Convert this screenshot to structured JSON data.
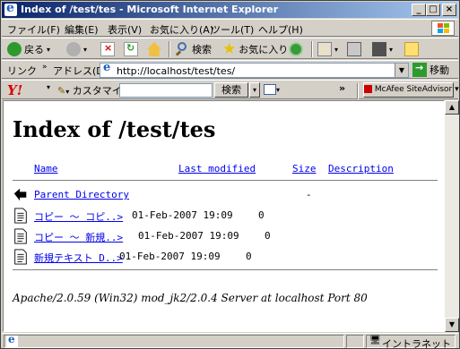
{
  "window": {
    "title": "Index of /test/tes - Microsoft Internet Explorer",
    "minimize": "_",
    "maximize": "□",
    "close": "×"
  },
  "menu": {
    "items": [
      "ファイル(F)",
      "編集(E)",
      "表示(V)",
      "お気に入り(A)",
      "ツール(T)",
      "ヘルプ(H)"
    ]
  },
  "toolbar": {
    "back_label": "戻る",
    "search_label": "検索",
    "favorites_label": "お気に入り"
  },
  "address": {
    "label": "リンク",
    "address_label": "アドレス(D)",
    "url": "http://localhost/test/tes/",
    "go_label": "移動"
  },
  "yahoo": {
    "logo": "Y!",
    "customize_label": "カスタマイズ",
    "search_button": "検索",
    "more": "»",
    "mcafee": "McAfee SiteAdvisor"
  },
  "page": {
    "heading": "Index of /test/tes",
    "columns": {
      "name": "Name",
      "last_modified": "Last modified",
      "size": "Size",
      "description": "Description"
    },
    "parent": {
      "label": "Parent Directory",
      "size": "-"
    },
    "entries": [
      {
        "name": "コピー ～ コピ..>",
        "modified": "01-Feb-2007 19:09",
        "size": "0"
      },
      {
        "name": "コピー ～ 新規..>",
        "modified": "01-Feb-2007 19:09",
        "size": "0"
      },
      {
        "name": "新規テキスト D..>",
        "modified": "01-Feb-2007 19:09",
        "size": "0"
      }
    ],
    "footer": "Apache/2.0.59 (Win32) mod_jk2/2.0.4 Server at localhost Port 80"
  },
  "status": {
    "zone": "イントラネット"
  },
  "colors": {
    "title_start": "#0a246a",
    "title_end": "#a6caf0",
    "link": "#0000ee",
    "chrome": "#d4d0c8"
  }
}
